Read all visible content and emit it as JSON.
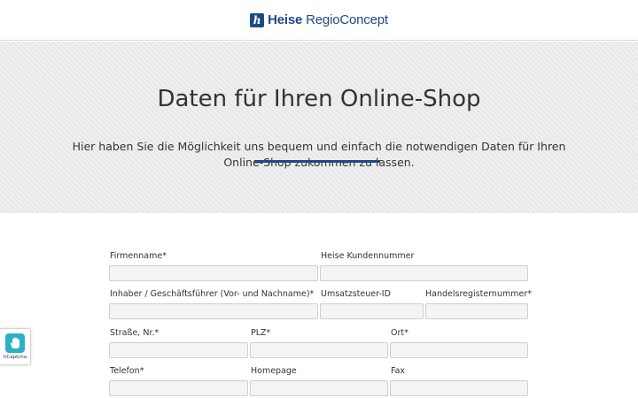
{
  "header": {
    "brand_bold": "Heise",
    "brand_regular": "RegioConcept"
  },
  "hero": {
    "title": "Daten für Ihren Online-Shop",
    "description": "Hier haben Sie die Möglichkeit uns bequem und einfach die notwendigen Daten für Ihren Online-Shop zukommen zu lassen."
  },
  "form": {
    "firmenname": {
      "label": "Firmenname*",
      "value": ""
    },
    "kundennummer": {
      "label": "Heise Kundennummer",
      "value": ""
    },
    "inhaber": {
      "label": "Inhaber / Geschäftsführer (Vor- und Nachname)*",
      "value": ""
    },
    "ust_id": {
      "label": "Umsatzsteuer-ID",
      "value": ""
    },
    "hrnr": {
      "label": "Handelsregisternummer*",
      "value": ""
    },
    "strasse": {
      "label": "Straße, Nr.*",
      "value": ""
    },
    "plz": {
      "label": "PLZ*",
      "value": ""
    },
    "ort": {
      "label": "Ort*",
      "value": ""
    },
    "telefon": {
      "label": "Telefon*",
      "value": ""
    },
    "homepage": {
      "label": "Homepage",
      "value": ""
    },
    "fax": {
      "label": "Fax",
      "value": ""
    }
  },
  "captcha": {
    "label": "hCaptcha",
    "icon": "hcaptcha-hand-icon",
    "color": "#2bb0c9"
  },
  "colors": {
    "brand": "#1d4a86",
    "hero_bg": "#ebebeb"
  }
}
